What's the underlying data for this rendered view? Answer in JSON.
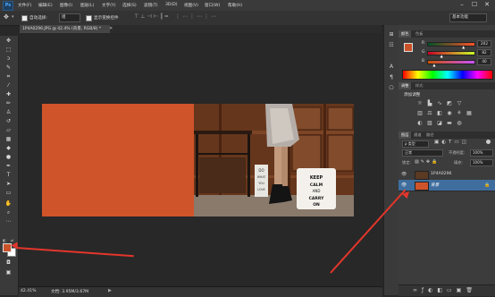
{
  "app": {
    "logo": "Ps",
    "menus": [
      "文件(F)",
      "编辑(E)",
      "图像(I)",
      "图层(L)",
      "文字(Y)",
      "选择(S)",
      "滤镜(T)",
      "3D(D)",
      "视图(V)",
      "窗口(W)",
      "帮助(H)"
    ],
    "window_controls": {
      "minimize": "–",
      "maximize": "☐",
      "close": "✕"
    }
  },
  "options_bar": {
    "auto_select_label": "自动选择:",
    "auto_select_value": "组",
    "show_transform_label": "显示变换控件",
    "workspace": "基本功能"
  },
  "document": {
    "tab_label": "1P4A0296.JPG @ 42.4% (背景, RGB/8) *",
    "photo_cushion_text": "KEEP CALM AND CARRY ON",
    "photo_card_text": "DO WHAT YOU LOVE"
  },
  "status_bar": {
    "zoom": "42.41%",
    "doc_info": "文档: 3.95M/3.67M"
  },
  "color_panel": {
    "tabs": [
      "颜色",
      "色板"
    ],
    "r_label": "R",
    "r_value": "202",
    "g_label": "G",
    "g_value": "82",
    "b_label": "B",
    "b_value": "40",
    "r_fraction": 0.79,
    "g_fraction": 0.32,
    "b_fraction": 0.16,
    "foreground": "#ca5228"
  },
  "adjustments_panel": {
    "tabs": [
      "调整",
      "样式"
    ],
    "title": "添加调整",
    "icons": [
      "brightness-icon",
      "levels-icon",
      "curves-icon",
      "exposure-icon",
      "vibrance-icon",
      "hue-icon",
      "color-balance-icon",
      "bw-icon",
      "photo-filter-icon",
      "channel-mixer-icon",
      "lookup-icon",
      "invert-icon",
      "posterize-icon",
      "threshold-icon",
      "gradient-map-icon",
      "selective-color-icon"
    ]
  },
  "layers_panel": {
    "tabs": [
      "图层",
      "通道",
      "路径"
    ],
    "filter_label": "ρ 类型",
    "blend_mode": "正常",
    "opacity_label": "不透明度:",
    "opacity_value": "100%",
    "lock_label": "锁定:",
    "fill_label": "填充:",
    "fill_value": "100%",
    "layers": [
      {
        "name": "1P4A0296",
        "selected": false
      },
      {
        "name": "背景",
        "selected": true,
        "swatch": "#d0542a"
      }
    ]
  },
  "colors": {
    "accent_orange": "#d0542a",
    "arrow_red": "#e3362b",
    "selected_layer": "#3f6e9e"
  }
}
